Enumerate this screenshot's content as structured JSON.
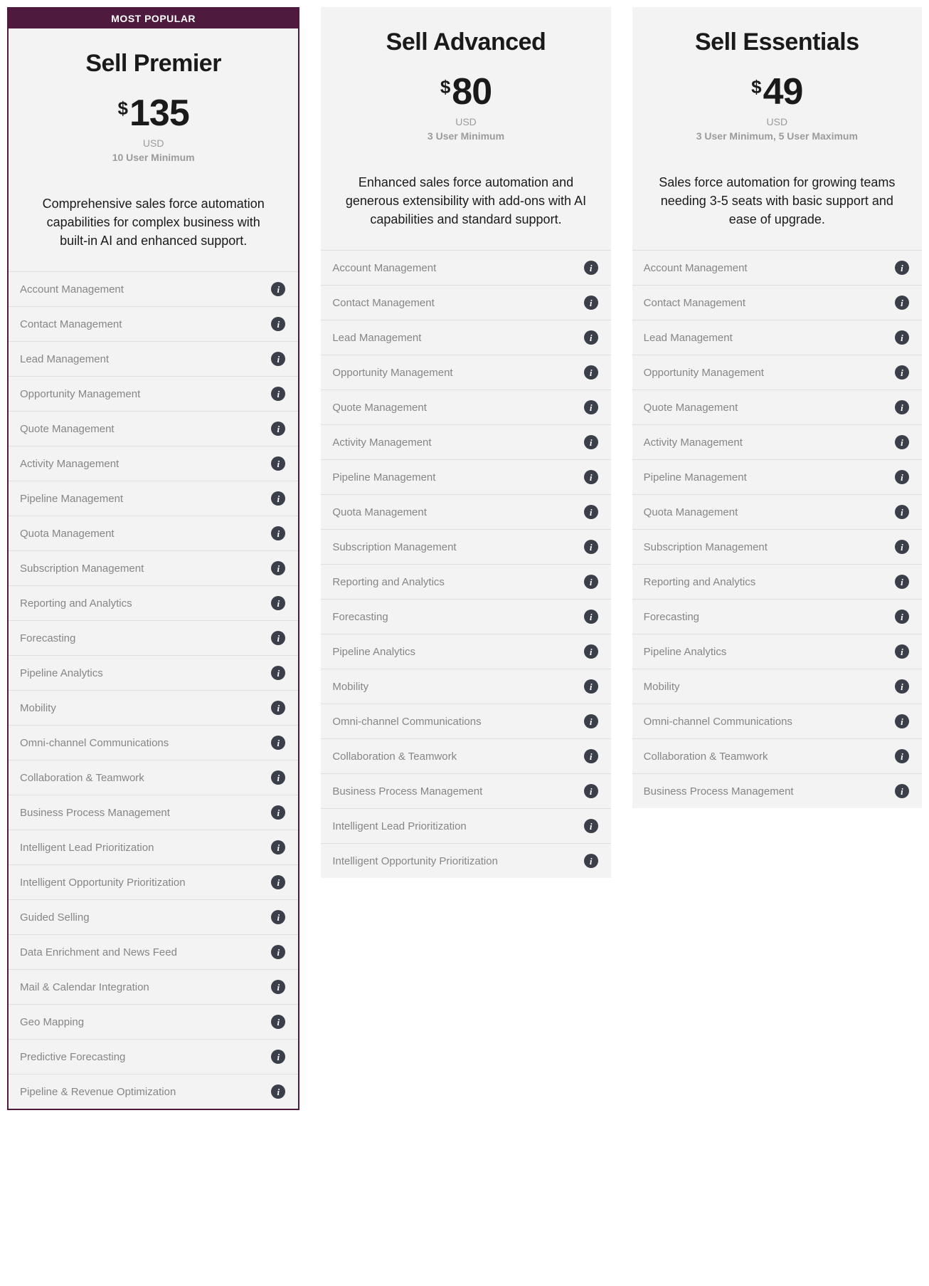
{
  "badge_label": "MOST POPULAR",
  "currency_symbol": "$",
  "info_glyph": "i",
  "plans": [
    {
      "id": "premier",
      "name": "Sell Premier",
      "price": "135",
      "currency": "USD",
      "users_note": "10 User Minimum",
      "popular": true,
      "description": "Comprehensive sales force automation capabilities for complex business with built-in AI and enhanced support.",
      "features": [
        "Account Management",
        "Contact Management",
        "Lead Management",
        "Opportunity Management",
        "Quote Management",
        "Activity Management",
        "Pipeline Management",
        "Quota Management",
        "Subscription Management",
        "Reporting and Analytics",
        "Forecasting",
        "Pipeline Analytics",
        "Mobility",
        "Omni-channel Communications",
        "Collaboration & Teamwork",
        "Business Process Management",
        "Intelligent Lead Prioritization",
        "Intelligent Opportunity Prioritization",
        "Guided Selling",
        "Data Enrichment and News Feed",
        "Mail & Calendar Integration",
        "Geo Mapping",
        "Predictive Forecasting",
        "Pipeline & Revenue Optimization"
      ]
    },
    {
      "id": "advanced",
      "name": "Sell Advanced",
      "price": "80",
      "currency": "USD",
      "users_note": "3 User Minimum",
      "popular": false,
      "description": "Enhanced sales force automation and generous extensibility with add-ons with AI capabilities and standard support.",
      "features": [
        "Account Management",
        "Contact Management",
        "Lead Management",
        "Opportunity Management",
        "Quote Management",
        "Activity Management",
        "Pipeline Management",
        "Quota Management",
        "Subscription Management",
        "Reporting and Analytics",
        "Forecasting",
        "Pipeline Analytics",
        "Mobility",
        "Omni-channel Communications",
        "Collaboration & Teamwork",
        "Business Process Management",
        "Intelligent Lead Prioritization",
        "Intelligent Opportunity Prioritization"
      ]
    },
    {
      "id": "essentials",
      "name": "Sell Essentials",
      "price": "49",
      "currency": "USD",
      "users_note": "3 User Minimum, 5 User Maximum",
      "popular": false,
      "description": "Sales force automation for growing teams needing 3-5 seats with basic support and ease of upgrade.",
      "features": [
        "Account Management",
        "Contact Management",
        "Lead Management",
        "Opportunity Management",
        "Quote Management",
        "Activity Management",
        "Pipeline Management",
        "Quota Management",
        "Subscription Management",
        "Reporting and Analytics",
        "Forecasting",
        "Pipeline Analytics",
        "Mobility",
        "Omni-channel Communications",
        "Collaboration & Teamwork",
        "Business Process Management"
      ]
    }
  ]
}
